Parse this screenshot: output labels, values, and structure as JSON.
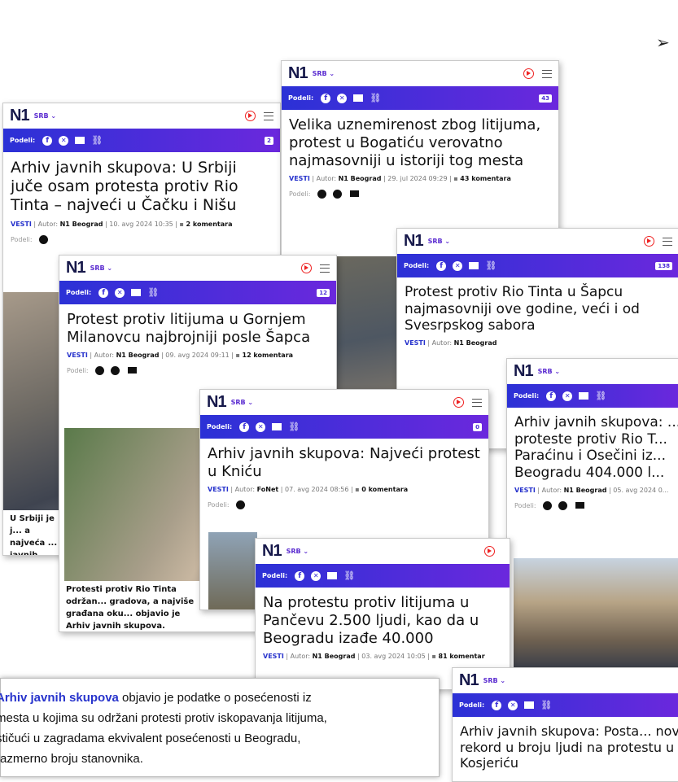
{
  "brand": {
    "logo": "N1",
    "region": "SRB",
    "share_label": "Podeli:",
    "category": "VESTI",
    "author_label": "Autor:"
  },
  "bullet": "➢",
  "cards": {
    "c1": {
      "title": "Arhiv javnih skupova: U Srbiji juče osam protesta protiv Rio Tinta – najveći u Čačku i Nišu",
      "author": "N1 Beograd",
      "date": "10. avg 2024 10:35",
      "comments": "2 komentara",
      "badge": "2",
      "caption": "U Srbiji je j... a najveća ... javnih sku..."
    },
    "c2": {
      "title": "Velika uznemirenost zbog litijuma, protest u Bogatiću verovatno najmasovniji u istoriji tog mesta",
      "author": "N1 Beograd",
      "date": "29. jul 2024 09:29",
      "comments": "43 komentara",
      "badge": "43"
    },
    "c3": {
      "title": "Protest protiv litijuma u Gornjem Milanovcu najbrojniji posle Šapca",
      "author": "N1 Beograd",
      "date": "09. avg 2024 09:11",
      "comments": "12 komentara",
      "badge": "12",
      "caption": "Protesti protiv Rio Tinta održan... gradova, a najviše građana oku... objavio je Arhiv javnih skupova."
    },
    "c4": {
      "title": "Protest protiv Rio Tinta u Šapcu najmasovniji ove godine, veći i od Svesrpskog sabora",
      "author": "N1 Beograd",
      "badge": "138"
    },
    "c5": {
      "title": "Arhiv javnih skupova: Najveći protest u Kniću",
      "author": "FoNet",
      "date": "07. avg 2024 08:56",
      "comments": "0 komentara",
      "badge": "0"
    },
    "c6": {
      "title": "Arhiv javnih skupova: ... proteste protiv Rio T... Paraćinu i Osečini iz... Beogradu 404.000 l...",
      "author": "N1 Beograd",
      "date": "05. avg 2024 0..."
    },
    "c7": {
      "title": "Na protestu protiv litijuma u Pančevu 2.500 ljudi, kao da u Beogradu izađe 40.000",
      "author": "N1 Beograd",
      "date": "03. avg 2024 10:05",
      "comments": "81 komentar"
    },
    "c8": {
      "title": "Arhiv javnih skupova: Posta... novi rekord u broju ljudi na protestu u Kosjeriću"
    }
  },
  "note": {
    "highlight": "Arhiv javnih skupova",
    "text1": " objavio je podatke o posećenosti iz",
    "text2": "mesta u kojima su održani protesti protiv iskopavanja litijuma,",
    "text3": "stičući u zagradama ekvivalent posećenosti u Beogradu,",
    "text4": "razmerno broju stanovnika."
  }
}
